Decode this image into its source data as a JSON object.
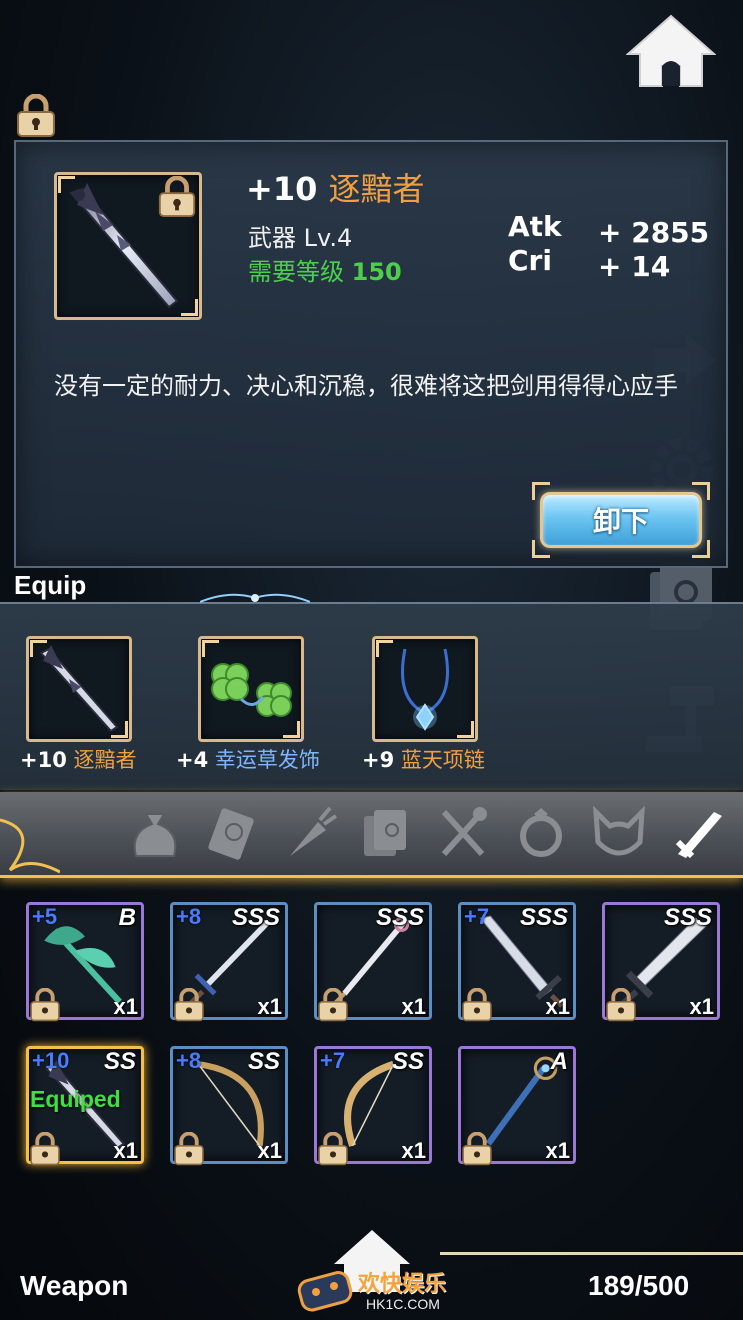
{
  "detail": {
    "plus": "+10",
    "name": "逐黯者",
    "type_level": "武器 Lv.4",
    "req_label": "需要等级",
    "req_value": "150",
    "stats": [
      {
        "label": "Atk",
        "value": "+ 2855"
      },
      {
        "label": "Cri",
        "value": "+ 14"
      }
    ],
    "description": "没有一定的耐力、决心和沉稳，很难将这把剑用得得心应手",
    "unequip_label": "卸下"
  },
  "equip": {
    "title": "Equip",
    "slots": [
      {
        "plus": "+10",
        "name": "逐黯者",
        "color": "#f0a040"
      },
      {
        "plus": "+4",
        "name": "幸运草发饰",
        "color": "#7eb6ff"
      },
      {
        "plus": "+9",
        "name": "蓝天项链",
        "color": "#f0a040"
      }
    ]
  },
  "tabs": [
    "bag-icon",
    "card-icon",
    "carrot-icon",
    "book-icon",
    "fork-spoon-icon",
    "ring-icon",
    "cat-ears-icon",
    "sword-icon"
  ],
  "active_tab": "sword-icon",
  "inventory": [
    {
      "plus": "+5",
      "grade": "B",
      "qty": "x1",
      "rarity": "purple",
      "equipped": ""
    },
    {
      "plus": "+8",
      "grade": "SSS",
      "qty": "x1",
      "rarity": "blue",
      "equipped": ""
    },
    {
      "plus": "",
      "grade": "SSS",
      "qty": "x1",
      "rarity": "blue",
      "equipped": ""
    },
    {
      "plus": "+7",
      "grade": "SSS",
      "qty": "x1",
      "rarity": "blue",
      "equipped": ""
    },
    {
      "plus": "",
      "grade": "SSS",
      "qty": "x1",
      "rarity": "purple",
      "equipped": ""
    },
    {
      "plus": "+10",
      "grade": "SS",
      "qty": "x1",
      "rarity": "gold",
      "equipped": "Equiped"
    },
    {
      "plus": "+8",
      "grade": "SS",
      "qty": "x1",
      "rarity": "blue",
      "equipped": ""
    },
    {
      "plus": "+7",
      "grade": "SS",
      "qty": "x1",
      "rarity": "purple",
      "equipped": ""
    },
    {
      "plus": "",
      "grade": "A",
      "qty": "x1",
      "rarity": "purple",
      "equipped": ""
    }
  ],
  "footer": {
    "title": "Weapon",
    "count": "189/500"
  },
  "watermark": {
    "cn": "欢快娱乐",
    "en": "HK1C.COM"
  }
}
